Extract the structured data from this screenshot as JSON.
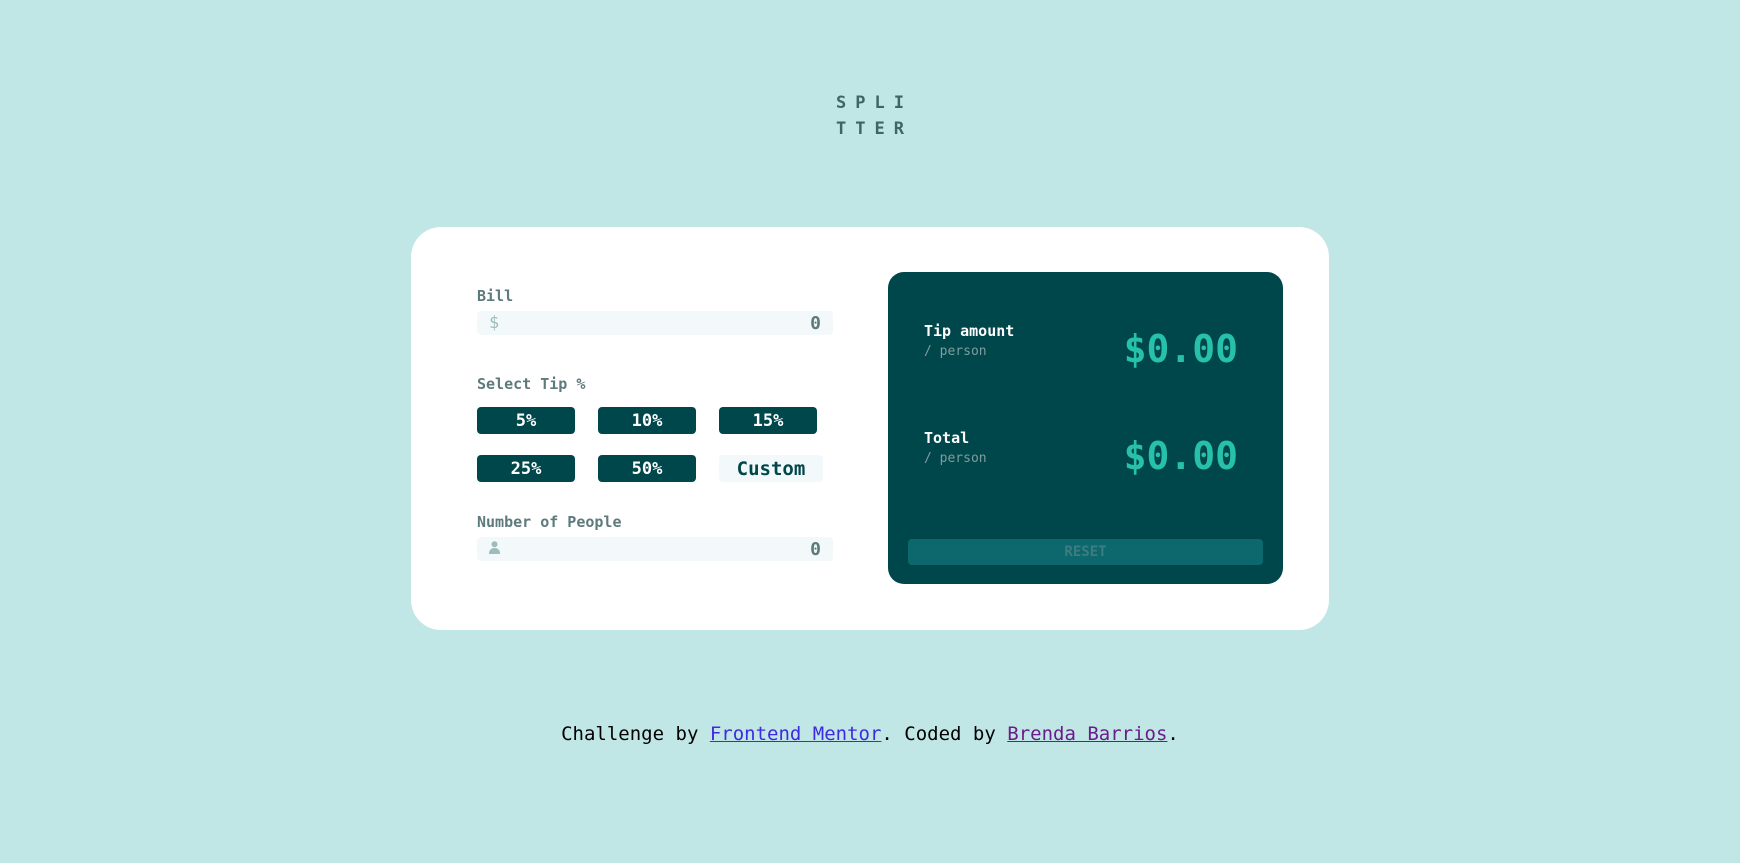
{
  "logo": {
    "line1": "SPLI",
    "line2": "TTER"
  },
  "bill": {
    "label": "Bill",
    "icon": "dollar-icon",
    "icon_glyph": "$",
    "value": "0"
  },
  "tip": {
    "label": "Select Tip %",
    "options": [
      "5%",
      "10%",
      "15%",
      "25%",
      "50%"
    ],
    "custom_label": "Custom"
  },
  "people": {
    "label": "Number of People",
    "icon": "person-icon",
    "value": "0"
  },
  "results": {
    "tip_title": "Tip amount",
    "tip_sub": "/ person",
    "tip_value": "$0.00",
    "total_title": "Total",
    "total_sub": "/ person",
    "total_value": "$0.00",
    "reset_label": "RESET"
  },
  "footer": {
    "prefix": "Challenge by ",
    "link1": "Frontend Mentor",
    "middle": ". Coded by ",
    "link2": "Brenda Barrios",
    "suffix": "."
  },
  "colors": {
    "background": "#c0e6e5",
    "primary": "#00474b",
    "accent": "#26c0ab",
    "input_bg": "#f3f9fa"
  }
}
